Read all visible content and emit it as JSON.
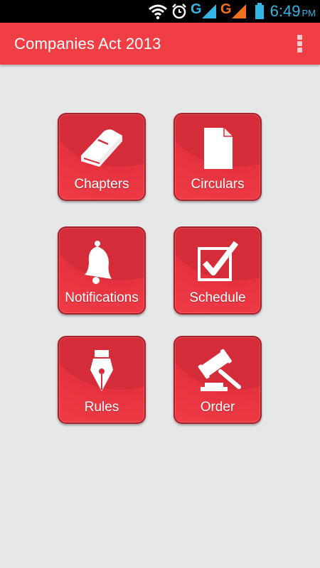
{
  "status_bar": {
    "time": "6:49",
    "ampm": "PM",
    "network_1": "G",
    "network_2": "G",
    "icons": [
      "wifi-icon",
      "alarm-icon",
      "signal-icon",
      "signal-icon",
      "battery-icon"
    ]
  },
  "app_bar": {
    "title": "Companies Act 2013",
    "menu_icon": "overflow-menu-icon"
  },
  "menu": {
    "items": [
      {
        "label": "Chapters",
        "icon": "book-icon"
      },
      {
        "label": "Circulars",
        "icon": "document-icon"
      },
      {
        "label": "Notifications",
        "icon": "bell-icon"
      },
      {
        "label": "Schedule",
        "icon": "checkbox-icon"
      },
      {
        "label": "Rules",
        "icon": "pen-nib-icon"
      },
      {
        "label": "Order",
        "icon": "gavel-icon"
      }
    ]
  },
  "colors": {
    "accent": "#f03e44",
    "tile_dark": "#d42c38",
    "background": "#e6e7e9",
    "status_text": "#33b5e5"
  }
}
